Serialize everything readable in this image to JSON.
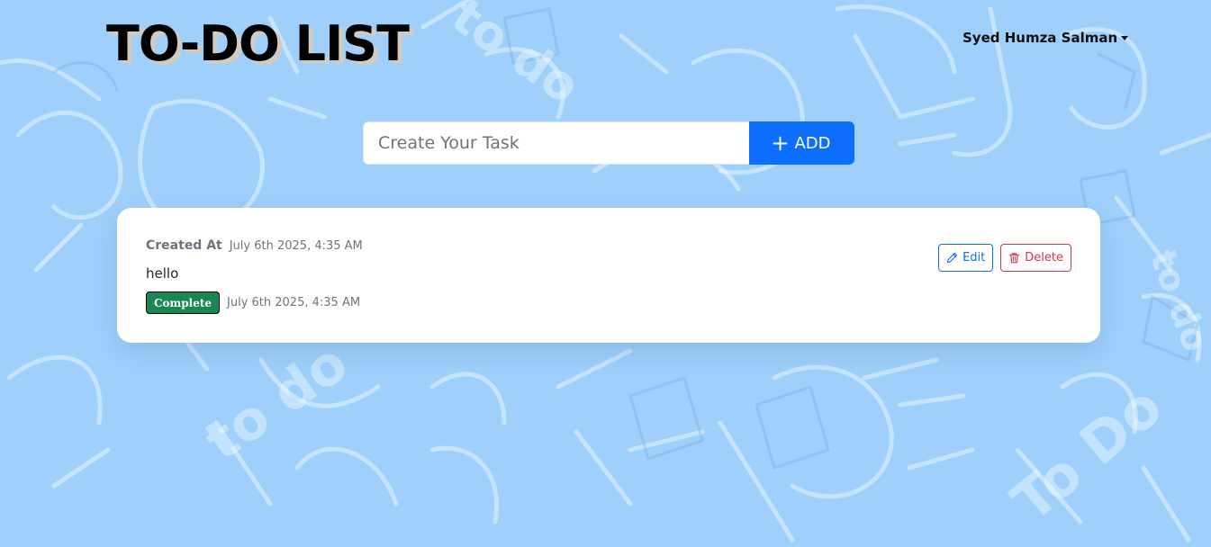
{
  "app": {
    "title": "TO-DO LIST"
  },
  "header": {
    "user_name": "Syed Humza Salman"
  },
  "task_form": {
    "placeholder": "Create Your Task",
    "value": "",
    "add_label": "ADD"
  },
  "tasks": [
    {
      "created_label": "Created At",
      "created_at": "July 6th 2025, 4:35 AM",
      "text": "hello",
      "status": "Complete",
      "status_time": "July 6th 2025, 4:35 AM",
      "edit_label": "Edit",
      "delete_label": "Delete"
    }
  ],
  "colors": {
    "background": "#9ed0fb",
    "primary": "#0d6efd",
    "success": "#198754",
    "danger": "#dc3545",
    "muted": "#6c757d"
  },
  "icons": {
    "add": "plus-icon",
    "edit": "pencil-icon",
    "delete": "trash-icon",
    "user_menu": "caret-down-icon"
  }
}
